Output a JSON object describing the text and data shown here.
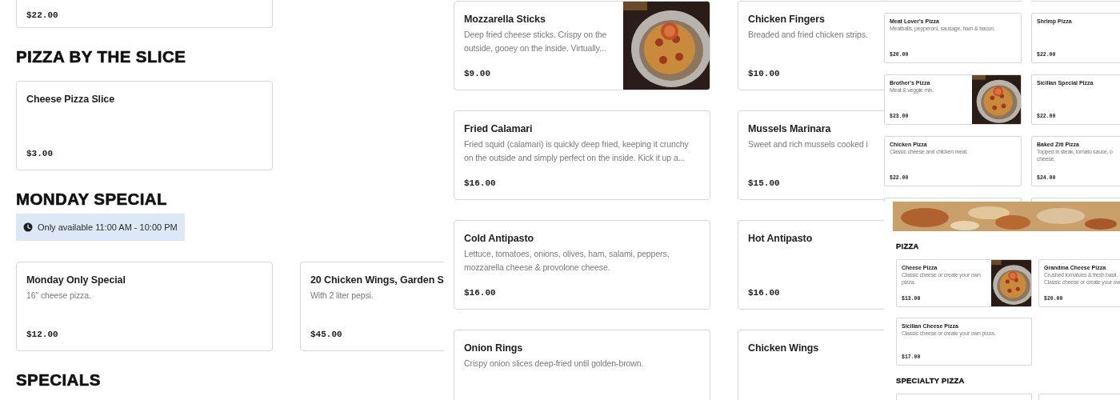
{
  "columns": [
    {
      "panels": [
        {
          "kind": "full",
          "blocks": [
            {
              "kind": "cards",
              "cards": [
                {
                  "kind": "tail",
                  "price": "$22.00"
                }
              ]
            },
            {
              "kind": "heading",
              "text": "PIZZA BY THE SLICE"
            },
            {
              "kind": "cards",
              "cards": [
                {
                  "kind": "full",
                  "name": "Cheese Pizza Slice",
                  "price": "$3.00"
                }
              ]
            },
            {
              "kind": "heading",
              "text": "MONDAY SPECIAL"
            },
            {
              "kind": "notice",
              "text": "Only available 11:00 AM - 10:00 PM"
            },
            {
              "kind": "cards",
              "cards": [
                {
                  "kind": "full",
                  "name": "Monday Only Special",
                  "description": "16\" cheese pizza.",
                  "price": "$12.00"
                },
                {
                  "kind": "full",
                  "name": "20 Chicken Wings, Garden S",
                  "description": "With 2 liter pepsi.",
                  "price": "$45.00"
                }
              ]
            },
            {
              "kind": "heading",
              "text": "SPECIALS"
            }
          ]
        }
      ]
    },
    {
      "panels": [
        {
          "kind": "full",
          "blocks": [
            {
              "kind": "cards",
              "cards": [
                {
                  "kind": "full",
                  "name": "Mozzarella Sticks",
                  "description": "Deep fried cheese sticks. Crispy on the outside, gooey on the inside. Virtually...",
                  "price": "$9.00",
                  "picture": true
                },
                {
                  "kind": "full",
                  "name": "Chicken Fingers",
                  "description": "Breaded and fried chicken strips.",
                  "price": "$10.00"
                }
              ]
            },
            {
              "kind": "cards",
              "cards": [
                {
                  "kind": "full",
                  "name": "Fried Calamari",
                  "description": "Fried squid (calamari) is quickly deep fried, keeping it crunchy on the outside and simply perfect on the inside. Kick it up a...",
                  "price": "$16.00"
                },
                {
                  "kind": "full",
                  "name": "Mussels Marinara",
                  "description": "Sweet and rich mussels cooked i",
                  "price": "$15.00"
                }
              ]
            },
            {
              "kind": "cards",
              "cards": [
                {
                  "kind": "full",
                  "name": "Cold Antipasto",
                  "description": "Lettuce, tomatoes, onions, olives, ham, salami, peppers, mozzarella cheese & provolone cheese.",
                  "price": "$16.00"
                },
                {
                  "kind": "full",
                  "name": "Hot Antipasto",
                  "price": "$16.00"
                }
              ]
            },
            {
              "kind": "cards",
              "cards": [
                {
                  "kind": "head",
                  "name": "Onion Rings",
                  "description": "Crispy onion slices deep-fried until golden-brown."
                },
                {
                  "kind": "head",
                  "name": "Chicken Wings"
                }
              ]
            }
          ]
        }
      ]
    },
    {
      "panels": [
        {
          "kind": "mini",
          "blocks": [
            {
              "kind": "cards",
              "cards": [
                {
                  "kind": "tail"
                },
                {
                  "kind": "tail"
                }
              ]
            },
            {
              "kind": "cards",
              "cards": [
                {
                  "kind": "full",
                  "name": "Meat Lover's Pizza",
                  "description": "Meatballs, pepperoni, sausage, ham & bacon.",
                  "price": "$20.00"
                },
                {
                  "kind": "full",
                  "name": "Shrimp Pizza",
                  "price": "$22.00"
                }
              ]
            },
            {
              "kind": "cards",
              "cards": [
                {
                  "kind": "full",
                  "name": "Brother's Pizza",
                  "description": "Meat & veggie mix.",
                  "price": "$23.00",
                  "picture": true
                },
                {
                  "kind": "full",
                  "name": "Sicilian Special Pizza",
                  "price": "$22.00"
                }
              ]
            },
            {
              "kind": "cards",
              "cards": [
                {
                  "kind": "full",
                  "name": "Chicken Pizza",
                  "description": "Classic cheese and chicken meat.",
                  "price": "$22.00"
                },
                {
                  "kind": "full",
                  "name": "Baked Ziti Pizza",
                  "description": "Topped in steak, tomato sauce, o\ncheese.",
                  "price": "$24.00"
                }
              ]
            },
            {
              "kind": "cards",
              "cards": [
                {
                  "kind": "head"
                },
                {
                  "kind": "head"
                }
              ]
            }
          ]
        },
        {
          "kind": "mini",
          "blocks": [
            {
              "kind": "banner"
            },
            {
              "kind": "heading",
              "text": "PIZZA"
            },
            {
              "kind": "cards",
              "cards": [
                {
                  "kind": "full",
                  "name": "Cheese Pizza",
                  "description": "Classic cheese or create your own\npizza.",
                  "price": "$13.00",
                  "picture": true
                },
                {
                  "kind": "full",
                  "name": "Grandma Cheese Pizza",
                  "description": "Crushed tomatoes & fresh basil.\nClassic cheese or create your ow",
                  "price": "$20.00"
                }
              ]
            },
            {
              "kind": "cards",
              "cards": [
                {
                  "kind": "full",
                  "name": "Sicilian Cheese Pizza",
                  "description": "Classic cheese or create your own pizza.",
                  "price": "$17.00"
                }
              ]
            },
            {
              "kind": "heading",
              "text": "SPECIALTY PIZZA"
            },
            {
              "kind": "cards",
              "cards": [
                {
                  "kind": "head"
                },
                {
                  "kind": "head"
                }
              ]
            }
          ]
        }
      ]
    }
  ]
}
